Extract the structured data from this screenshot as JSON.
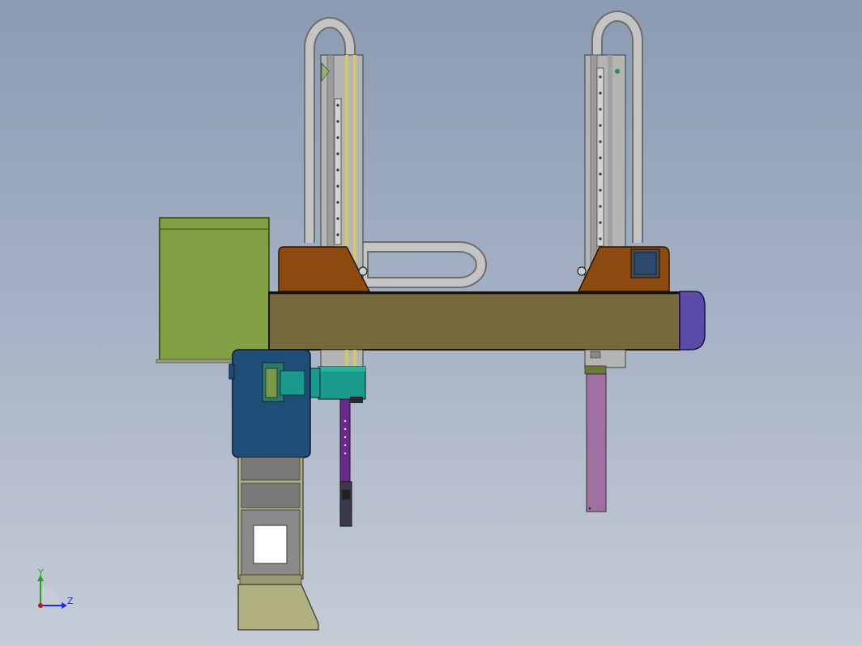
{
  "viewport": {
    "background_top": "#8b9bb3",
    "background_bottom": "#c6ccd6"
  },
  "triad": {
    "y_label": "Y",
    "z_label": "Z",
    "y_color": "#2aa02a",
    "z_color": "#1c2fd0",
    "origin_color": "#c01818"
  },
  "colors": {
    "beam": "#78693d",
    "end_cap": "#5b4aa8",
    "carriage": "#8c4a10",
    "motor_box": "#84a044",
    "gearbox": "#1e4d78",
    "servo": "#1a9a8c",
    "cable_chain": "#b8b8b8",
    "rail": "#a8a8a8",
    "rod_left": "#6a2a8a",
    "rod_right": "#a070a0",
    "base_plate": "#b0b080",
    "control_panel": "#2c4a6e"
  }
}
